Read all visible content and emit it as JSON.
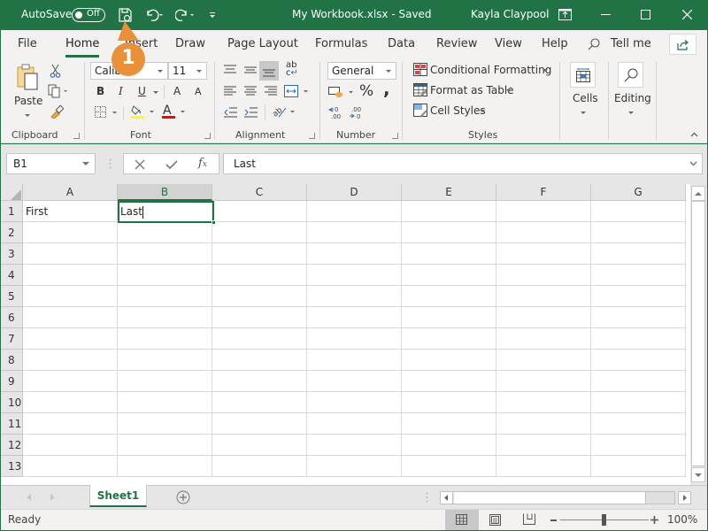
{
  "titlebar": {
    "autosave_label": "AutoSave",
    "autosave_state": "Off",
    "title": "My Workbook.xlsx  -  Saved",
    "user": "Kayla Claypool"
  },
  "tabs": [
    {
      "label": "File"
    },
    {
      "label": "Home",
      "active": true
    },
    {
      "label": "Insert"
    },
    {
      "label": "Draw"
    },
    {
      "label": "Page Layout"
    },
    {
      "label": "Formulas"
    },
    {
      "label": "Data"
    },
    {
      "label": "Review"
    },
    {
      "label": "View"
    },
    {
      "label": "Help"
    }
  ],
  "tell_me": "Tell me",
  "ribbon": {
    "clipboard": {
      "paste": "Paste",
      "label": "Clipboard"
    },
    "font": {
      "name": "Calibri",
      "size": "11",
      "bold": "B",
      "italic": "I",
      "underline": "U",
      "grow": "A",
      "shrink": "A",
      "label": "Font",
      "highlight_color": "#ffff00",
      "font_color": "#ff0000"
    },
    "alignment": {
      "label": "Alignment"
    },
    "number": {
      "format": "General",
      "percent": "%",
      "comma": ",",
      "label": "Number"
    },
    "styles": {
      "conditional": "Conditional Formatting",
      "format_table": "Format as Table",
      "cell_styles": "Cell Styles",
      "label": "Styles"
    },
    "cells": {
      "label": "Cells"
    },
    "editing": {
      "label": "Editing"
    }
  },
  "formula_bar": {
    "name_box": "B1",
    "formula": "Last"
  },
  "sheet": {
    "columns": [
      "A",
      "B",
      "C",
      "D",
      "E",
      "F",
      "G"
    ],
    "selected_column": "B",
    "rows": [
      "1",
      "2",
      "3",
      "4",
      "5",
      "6",
      "7",
      "8",
      "9",
      "10",
      "11",
      "12",
      "13"
    ],
    "cells": {
      "A1": "First",
      "B1": "Last"
    },
    "active_cell": "B1"
  },
  "sheet_tabs": [
    {
      "label": "Sheet1",
      "active": true
    }
  ],
  "status": {
    "mode": "Ready",
    "zoom": "100%",
    "zoom_percent": 100
  },
  "callout": {
    "number": "1"
  },
  "colors": {
    "accent": "#217346",
    "callout": "#e8913a"
  }
}
